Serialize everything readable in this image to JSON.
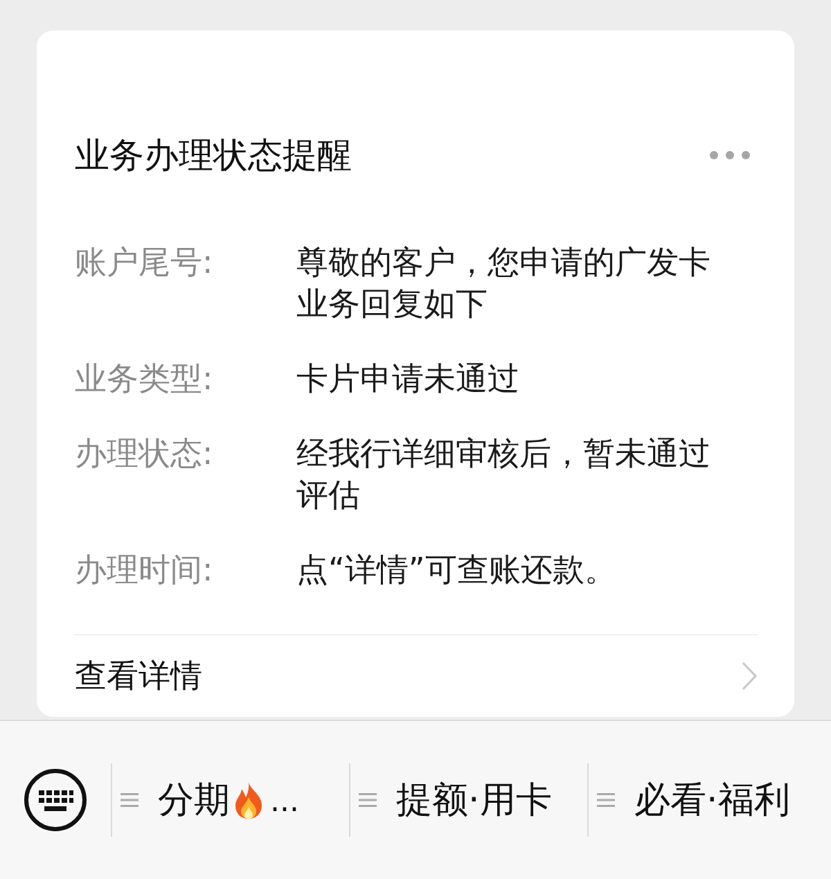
{
  "card": {
    "title": "业务办理状态提醒",
    "fields": [
      {
        "label": "账户尾号:",
        "value": "尊敬的客户，您申请的广发卡业务回复如下"
      },
      {
        "label": "业务类型:",
        "value": "卡片申请未通过"
      },
      {
        "label": "办理状态:",
        "value": "经我行详细审核后，暂未通过评估"
      },
      {
        "label": "办理时间:",
        "value": "点“详情”可查账还款。"
      }
    ],
    "link": "查看详情"
  },
  "menu_bar": {
    "items": [
      {
        "kind": "hot",
        "label": "分期",
        "suffix": "..."
      },
      {
        "kind": "plain",
        "label": "提额·用卡"
      },
      {
        "kind": "plain",
        "label": "必看·福利"
      }
    ]
  }
}
